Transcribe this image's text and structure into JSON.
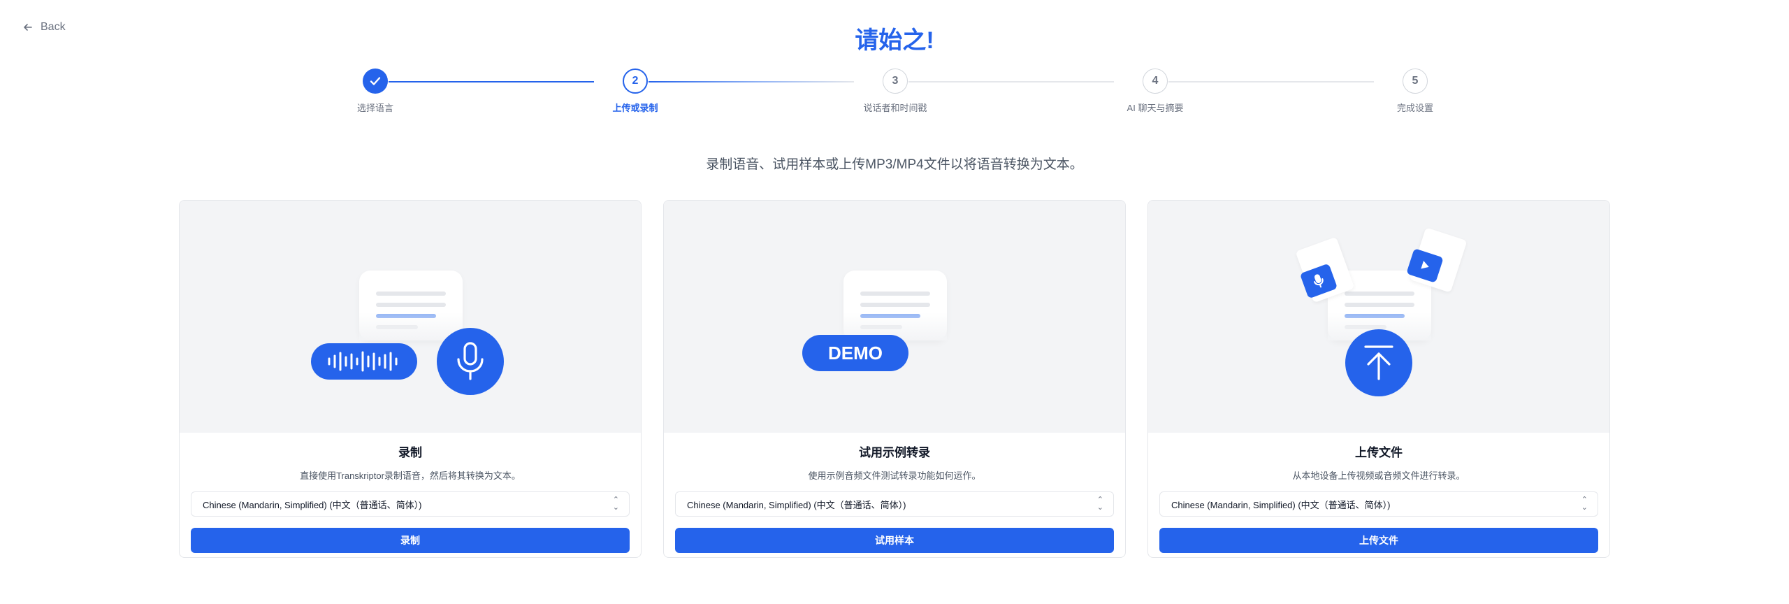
{
  "back_label": "Back",
  "page_title": "请始之!",
  "steps": [
    {
      "number": "",
      "label": "选择语言",
      "state": "done"
    },
    {
      "number": "2",
      "label": "上传或录制",
      "state": "active"
    },
    {
      "number": "3",
      "label": "说话者和时间戳",
      "state": "todo"
    },
    {
      "number": "4",
      "label": "AI 聊天与摘要",
      "state": "todo"
    },
    {
      "number": "5",
      "label": "完成设置",
      "state": "todo"
    }
  ],
  "subtitle": "录制语音、试用样本或上传MP3/MP4文件以将语音转换为文本。",
  "cards": [
    {
      "title": "录制",
      "description": "直接使用Transkriptor录制语音，然后将其转换为文本。",
      "language": "Chinese (Mandarin, Simplified) (中文（普通话、简体）)",
      "button": "录制"
    },
    {
      "title": "试用示例转录",
      "description": "使用示例音频文件测试转录功能如何运作。",
      "language": "Chinese (Mandarin, Simplified) (中文（普通话、简体）)",
      "button": "试用样本",
      "demo_label": "DEMO"
    },
    {
      "title": "上传文件",
      "description": "从本地设备上传视频或音频文件进行转录。",
      "language": "Chinese (Mandarin, Simplified) (中文（普通话、简体）)",
      "button": "上传文件"
    }
  ],
  "colors": {
    "accent": "#2563eb",
    "illustration_bg": "#f3f4f6",
    "border": "#e5e7eb",
    "muted_text": "#6b7280"
  },
  "icons": [
    "arrow-left-icon",
    "check-icon",
    "waveform-icon",
    "microphone-icon",
    "upload-arrow-icon",
    "play-icon",
    "chevron-up-down-icon"
  ]
}
